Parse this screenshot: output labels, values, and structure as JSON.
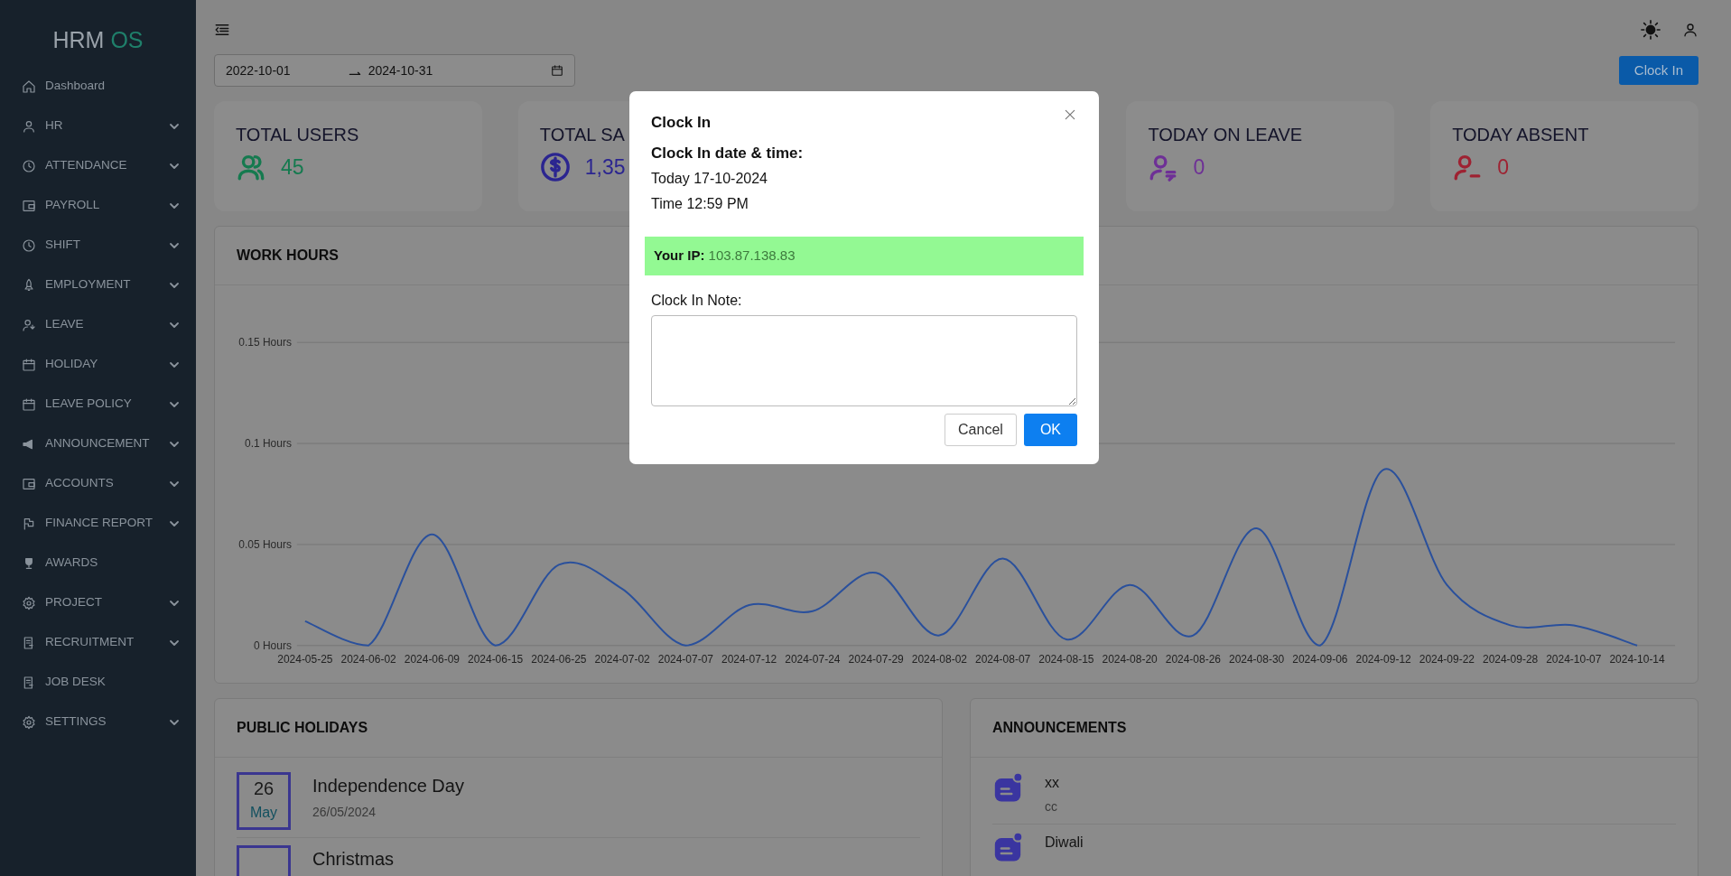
{
  "sidebar": {
    "logo": {
      "text": "HRM",
      "accent": "OS"
    },
    "items": [
      {
        "label": "Dashboard",
        "collapsible": false
      },
      {
        "label": "HR",
        "collapsible": true
      },
      {
        "label": "ATTENDANCE",
        "collapsible": true
      },
      {
        "label": "PAYROLL",
        "collapsible": true
      },
      {
        "label": "SHIFT",
        "collapsible": true
      },
      {
        "label": "EMPLOYMENT",
        "collapsible": true
      },
      {
        "label": "LEAVE",
        "collapsible": true
      },
      {
        "label": "HOLIDAY",
        "collapsible": true
      },
      {
        "label": "LEAVE POLICY",
        "collapsible": true
      },
      {
        "label": "ANNOUNCEMENT",
        "collapsible": true
      },
      {
        "label": "ACCOUNTS",
        "collapsible": true
      },
      {
        "label": "FINANCE REPORT",
        "collapsible": true
      },
      {
        "label": "AWARDS",
        "collapsible": false
      },
      {
        "label": "PROJECT",
        "collapsible": true
      },
      {
        "label": "RECRUITMENT",
        "collapsible": true
      },
      {
        "label": "JOB DESK",
        "collapsible": false
      },
      {
        "label": "SETTINGS",
        "collapsible": true
      }
    ]
  },
  "date_range": {
    "start": "2022-10-01",
    "end": "2024-10-31"
  },
  "clock_in_button": "Clock In",
  "stat_cards": [
    {
      "title": "TOTAL USERS",
      "value": "45",
      "color": "#157a4f"
    },
    {
      "title": "TOTAL SA",
      "value": "1,35",
      "color": "#2b2590"
    },
    {
      "title": "TODAY ON LEAVE",
      "value": "0",
      "color": "#6e3096"
    },
    {
      "title": "TODAY ABSENT",
      "value": "0",
      "color": "#9e2232"
    }
  ],
  "work_hours": {
    "title": "WORK HOURS",
    "chart_data": {
      "type": "line",
      "grid": true,
      "ylim": [
        0,
        0.15
      ],
      "categories": [
        "2024-05-25",
        "2024-06-02",
        "2024-06-09",
        "2024-06-15",
        "2024-06-25",
        "2024-07-02",
        "2024-07-07",
        "2024-07-12",
        "2024-07-24",
        "2024-07-29",
        "2024-08-02",
        "2024-08-07",
        "2024-08-15",
        "2024-08-20",
        "2024-08-26",
        "2024-08-30",
        "2024-09-06",
        "2024-09-12",
        "2024-09-22",
        "2024-09-28",
        "2024-10-07",
        "2024-10-14"
      ],
      "values": [
        0.012,
        0.0,
        0.055,
        0.0,
        0.04,
        0.028,
        0.0,
        0.02,
        0.017,
        0.036,
        0.005,
        0.043,
        0.003,
        0.03,
        0.005,
        0.058,
        0.0,
        0.087,
        0.03,
        0.01,
        0.01,
        0.0
      ],
      "yticks": [
        {
          "value": 0,
          "label": "0 Hours"
        },
        {
          "value": 0.05,
          "label": "0.05 Hours"
        },
        {
          "value": 0.1,
          "label": "0.1 Hours"
        },
        {
          "value": 0.15,
          "label": "0.15 Hours"
        }
      ]
    }
  },
  "public_holidays": {
    "title": "PUBLIC HOLIDAYS",
    "items": [
      {
        "day": "26",
        "month": "May",
        "name": "Independence Day",
        "date": "26/05/2024"
      },
      {
        "name": "Christmas"
      }
    ]
  },
  "announcements": {
    "title": "ANNOUNCEMENTS",
    "items": [
      {
        "title": "xx",
        "text": "cc"
      },
      {
        "title": "Diwali"
      }
    ]
  },
  "modal": {
    "title": "Clock In",
    "heading": "Clock In date & time:",
    "today": "Today 17-10-2024",
    "time": "Time 12:59 PM",
    "ip_label": "Your IP:",
    "ip": "103.87.138.83",
    "note_label": "Clock In Note:",
    "cancel": "Cancel",
    "ok": "OK"
  }
}
